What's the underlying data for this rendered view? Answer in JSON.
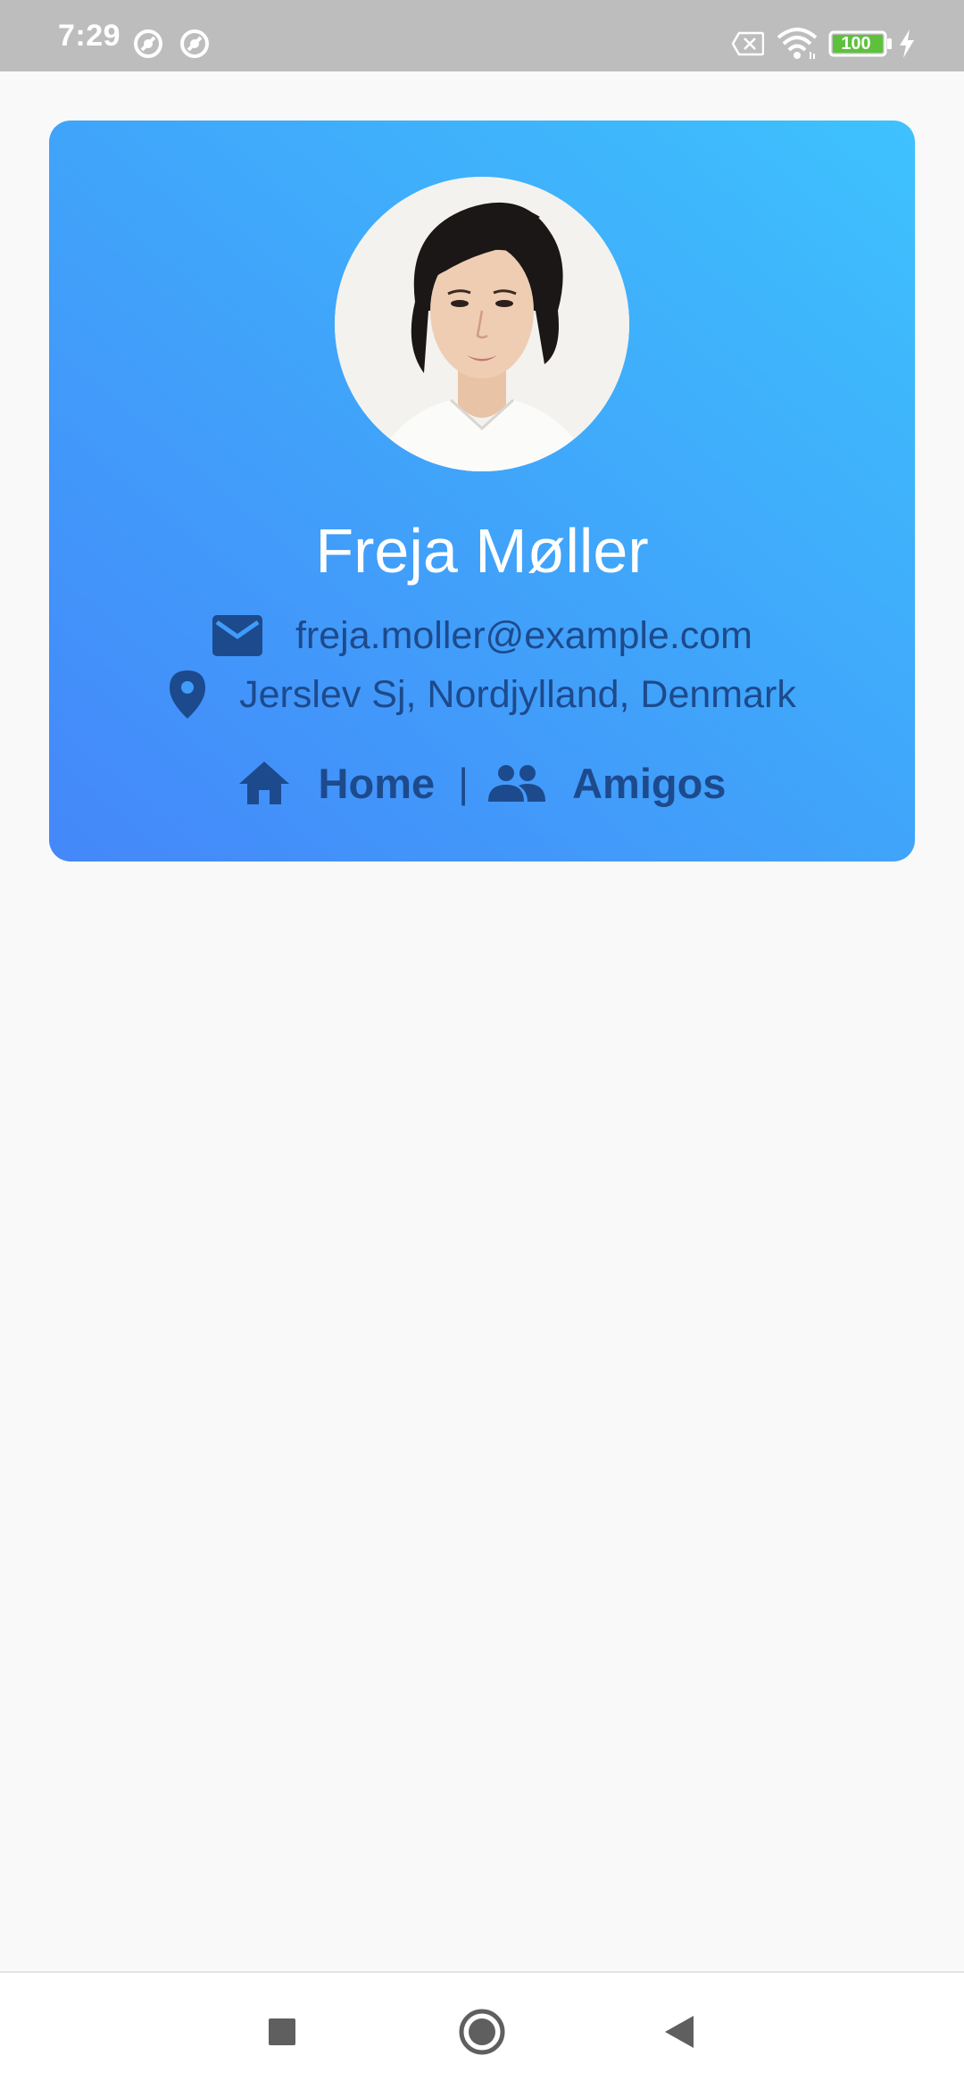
{
  "status_bar": {
    "time": "7:29",
    "battery_level": "100",
    "icons": [
      "app-notification-icon",
      "app-notification-icon",
      "no-sim-icon",
      "wifi-icon",
      "battery-icon",
      "charging-icon"
    ],
    "battery_color": "#5ec13b"
  },
  "profile": {
    "name": "Freja Møller",
    "email": "freja.moller@example.com",
    "location": "Jerslev Sj, Nordjylland, Denmark",
    "avatar_icon": "profile-photo",
    "email_icon": "mail-icon",
    "location_icon": "location-pin-icon",
    "links": {
      "home_label": "Home",
      "separator": "|",
      "friends_label": "Amigos",
      "home_icon": "home-icon",
      "friends_icon": "people-icon"
    }
  },
  "colors": {
    "card_gradient_start": "#4487f9",
    "card_gradient_end": "#3ec2fe",
    "accent_text": "#1d4a8c",
    "name_text": "#ffffff",
    "background": "#f9f9f9"
  },
  "nav_bar": {
    "buttons": [
      "recents-square-icon",
      "home-circle-icon",
      "back-triangle-icon"
    ]
  }
}
